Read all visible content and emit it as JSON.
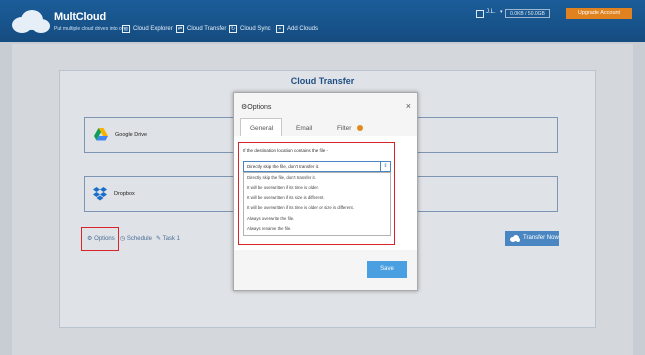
{
  "header": {
    "brand": "MultCloud",
    "tagline": "Put multiple cloud drives into one",
    "nav": [
      {
        "label": "Cloud Explorer",
        "icon": "explorer-icon"
      },
      {
        "label": "Cloud Transfer",
        "icon": "transfer-icon"
      },
      {
        "label": "Cloud Sync",
        "icon": "sync-icon"
      },
      {
        "label": "Add Clouds",
        "icon": "add-icon"
      }
    ],
    "user_initial": "J.L.",
    "search_text": "0.0KB / 50.0GB",
    "upgrade_label": "Upgrade Account"
  },
  "page": {
    "title": "Cloud Transfer",
    "source": {
      "name": "Google Drive"
    },
    "destination": {
      "name": "Dropbox"
    },
    "options_link": "Options",
    "schedule_link": "Schedule",
    "task_link": "Task 1",
    "transfer_now": "Transfer Now"
  },
  "modal": {
    "title": "Options",
    "close": "×",
    "tabs": [
      "General",
      "Email",
      "Filter"
    ],
    "prompt": "If the destination location contains the file -",
    "selected": "Directly skip the file, don't transfer it.",
    "options": [
      "Directly skip the file, don't transfer it.",
      "It will be overwritten if its time is older.",
      "It will be overwritten if its size is different.",
      "It will be overwritten if its time is older or size is different.",
      "Always overwrite the file.",
      "Always rename the file."
    ],
    "save_label": "Save"
  },
  "colors": {
    "header_bg": "#1b5d99",
    "accent": "#4a87c2",
    "upgrade": "#e0821f",
    "highlight": "#d9252a",
    "save": "#4a9fe0"
  }
}
